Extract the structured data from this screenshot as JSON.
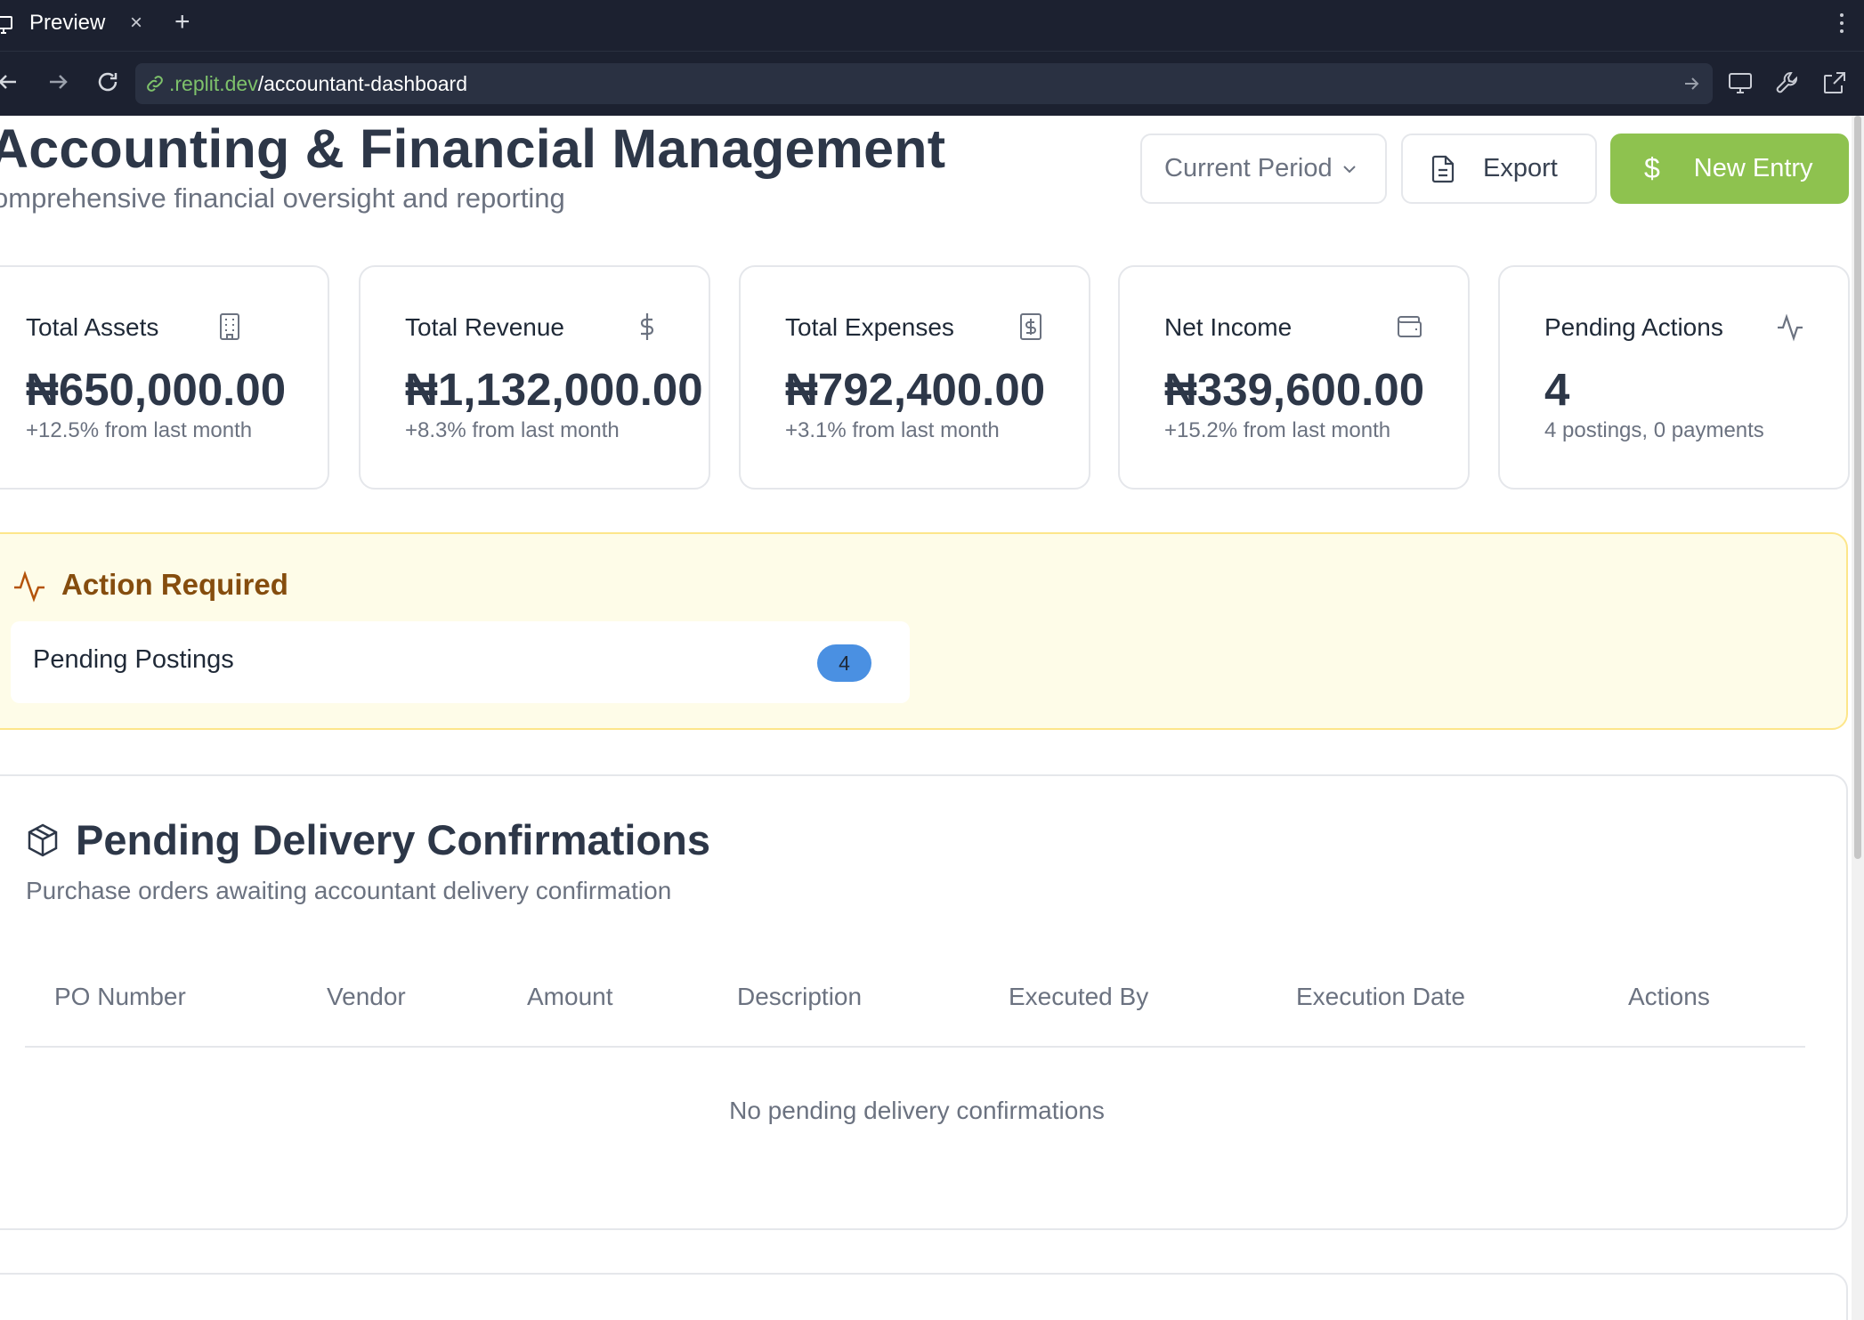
{
  "browser": {
    "tab_title": "Preview",
    "tab_close": "×",
    "tab_new": "+",
    "url_host": ".replit.dev",
    "url_path": "/accountant-dashboard"
  },
  "header": {
    "title": "Accounting & Financial Management",
    "subtitle": "omprehensive financial oversight and reporting",
    "period_select": "Current Period",
    "export_label": "Export",
    "new_entry_label": "New Entry",
    "new_entry_icon": "$"
  },
  "stats": [
    {
      "label": "Total Assets",
      "value": "₦650,000.00",
      "sub": "+12.5% from last month",
      "icon": "building-icon"
    },
    {
      "label": "Total Revenue",
      "value": "₦1,132,000.00",
      "sub": "+8.3% from last month",
      "icon": "dollar-icon"
    },
    {
      "label": "Total Expenses",
      "value": "₦792,400.00",
      "sub": "+3.1% from last month",
      "icon": "receipt-icon"
    },
    {
      "label": "Net Income",
      "value": "₦339,600.00",
      "sub": "+15.2% from last month",
      "icon": "wallet-icon"
    },
    {
      "label": "Pending Actions",
      "value": "4",
      "sub": "4 postings, 0 payments",
      "icon": "activity-icon"
    }
  ],
  "action_required": {
    "title": "Action Required",
    "items": [
      {
        "label": "Pending Postings",
        "count": "4"
      }
    ]
  },
  "delivery": {
    "title": "Pending Delivery Confirmations",
    "subtitle": "Purchase orders awaiting accountant delivery confirmation",
    "columns": [
      "PO Number",
      "Vendor",
      "Amount",
      "Description",
      "Executed By",
      "Execution Date",
      "Actions"
    ],
    "empty": "No pending delivery confirmations"
  },
  "colors": {
    "accent_green": "#8ec24f",
    "badge_blue": "#4a90e2",
    "warning_bg": "#fefce8",
    "warning_text": "#854d0e"
  }
}
